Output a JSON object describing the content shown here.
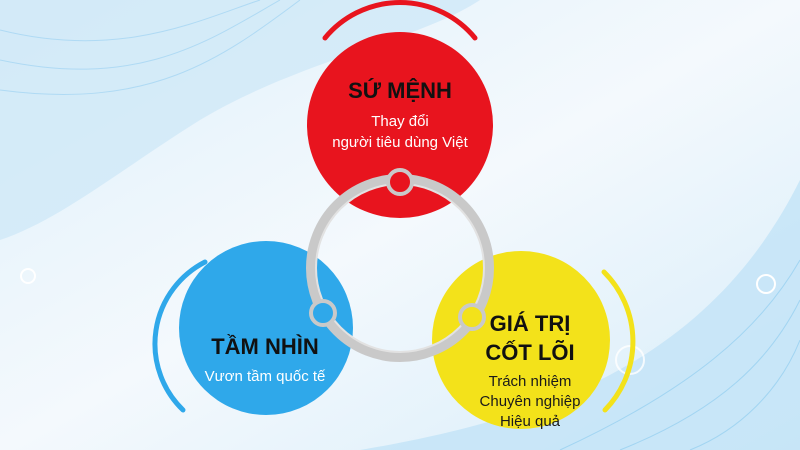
{
  "colors": {
    "mission": "#e8141e",
    "vision": "#2fa8ea",
    "values": "#f3e21a",
    "ring": "#c9c9c9",
    "background": "#eef6fc",
    "wave": "#bfe3f7"
  },
  "mission": {
    "title": "SỨ MỆNH",
    "line1": "Thay đổi",
    "line2": "người tiêu dùng Việt"
  },
  "vision": {
    "title": "TẦM NHÌN",
    "line1": "Vươn tầm quốc tế"
  },
  "values": {
    "title1": "GIÁ TRỊ",
    "title2": "CỐT LÕI",
    "line1": "Trách nhiệm",
    "line2": "Chuyên nghiệp",
    "line3": "Hiệu quả"
  }
}
